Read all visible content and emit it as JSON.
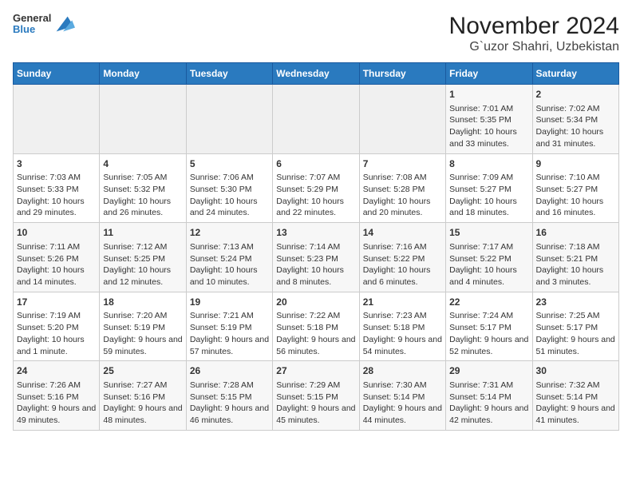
{
  "header": {
    "logo_line1": "General",
    "logo_line2": "Blue",
    "title": "November 2024",
    "subtitle": "G`uzor Shahri, Uzbekistan"
  },
  "weekdays": [
    "Sunday",
    "Monday",
    "Tuesday",
    "Wednesday",
    "Thursday",
    "Friday",
    "Saturday"
  ],
  "weeks": [
    [
      {
        "day": "",
        "info": ""
      },
      {
        "day": "",
        "info": ""
      },
      {
        "day": "",
        "info": ""
      },
      {
        "day": "",
        "info": ""
      },
      {
        "day": "",
        "info": ""
      },
      {
        "day": "1",
        "info": "Sunrise: 7:01 AM\nSunset: 5:35 PM\nDaylight: 10 hours and 33 minutes."
      },
      {
        "day": "2",
        "info": "Sunrise: 7:02 AM\nSunset: 5:34 PM\nDaylight: 10 hours and 31 minutes."
      }
    ],
    [
      {
        "day": "3",
        "info": "Sunrise: 7:03 AM\nSunset: 5:33 PM\nDaylight: 10 hours and 29 minutes."
      },
      {
        "day": "4",
        "info": "Sunrise: 7:05 AM\nSunset: 5:32 PM\nDaylight: 10 hours and 26 minutes."
      },
      {
        "day": "5",
        "info": "Sunrise: 7:06 AM\nSunset: 5:30 PM\nDaylight: 10 hours and 24 minutes."
      },
      {
        "day": "6",
        "info": "Sunrise: 7:07 AM\nSunset: 5:29 PM\nDaylight: 10 hours and 22 minutes."
      },
      {
        "day": "7",
        "info": "Sunrise: 7:08 AM\nSunset: 5:28 PM\nDaylight: 10 hours and 20 minutes."
      },
      {
        "day": "8",
        "info": "Sunrise: 7:09 AM\nSunset: 5:27 PM\nDaylight: 10 hours and 18 minutes."
      },
      {
        "day": "9",
        "info": "Sunrise: 7:10 AM\nSunset: 5:27 PM\nDaylight: 10 hours and 16 minutes."
      }
    ],
    [
      {
        "day": "10",
        "info": "Sunrise: 7:11 AM\nSunset: 5:26 PM\nDaylight: 10 hours and 14 minutes."
      },
      {
        "day": "11",
        "info": "Sunrise: 7:12 AM\nSunset: 5:25 PM\nDaylight: 10 hours and 12 minutes."
      },
      {
        "day": "12",
        "info": "Sunrise: 7:13 AM\nSunset: 5:24 PM\nDaylight: 10 hours and 10 minutes."
      },
      {
        "day": "13",
        "info": "Sunrise: 7:14 AM\nSunset: 5:23 PM\nDaylight: 10 hours and 8 minutes."
      },
      {
        "day": "14",
        "info": "Sunrise: 7:16 AM\nSunset: 5:22 PM\nDaylight: 10 hours and 6 minutes."
      },
      {
        "day": "15",
        "info": "Sunrise: 7:17 AM\nSunset: 5:22 PM\nDaylight: 10 hours and 4 minutes."
      },
      {
        "day": "16",
        "info": "Sunrise: 7:18 AM\nSunset: 5:21 PM\nDaylight: 10 hours and 3 minutes."
      }
    ],
    [
      {
        "day": "17",
        "info": "Sunrise: 7:19 AM\nSunset: 5:20 PM\nDaylight: 10 hours and 1 minute."
      },
      {
        "day": "18",
        "info": "Sunrise: 7:20 AM\nSunset: 5:19 PM\nDaylight: 9 hours and 59 minutes."
      },
      {
        "day": "19",
        "info": "Sunrise: 7:21 AM\nSunset: 5:19 PM\nDaylight: 9 hours and 57 minutes."
      },
      {
        "day": "20",
        "info": "Sunrise: 7:22 AM\nSunset: 5:18 PM\nDaylight: 9 hours and 56 minutes."
      },
      {
        "day": "21",
        "info": "Sunrise: 7:23 AM\nSunset: 5:18 PM\nDaylight: 9 hours and 54 minutes."
      },
      {
        "day": "22",
        "info": "Sunrise: 7:24 AM\nSunset: 5:17 PM\nDaylight: 9 hours and 52 minutes."
      },
      {
        "day": "23",
        "info": "Sunrise: 7:25 AM\nSunset: 5:17 PM\nDaylight: 9 hours and 51 minutes."
      }
    ],
    [
      {
        "day": "24",
        "info": "Sunrise: 7:26 AM\nSunset: 5:16 PM\nDaylight: 9 hours and 49 minutes."
      },
      {
        "day": "25",
        "info": "Sunrise: 7:27 AM\nSunset: 5:16 PM\nDaylight: 9 hours and 48 minutes."
      },
      {
        "day": "26",
        "info": "Sunrise: 7:28 AM\nSunset: 5:15 PM\nDaylight: 9 hours and 46 minutes."
      },
      {
        "day": "27",
        "info": "Sunrise: 7:29 AM\nSunset: 5:15 PM\nDaylight: 9 hours and 45 minutes."
      },
      {
        "day": "28",
        "info": "Sunrise: 7:30 AM\nSunset: 5:14 PM\nDaylight: 9 hours and 44 minutes."
      },
      {
        "day": "29",
        "info": "Sunrise: 7:31 AM\nSunset: 5:14 PM\nDaylight: 9 hours and 42 minutes."
      },
      {
        "day": "30",
        "info": "Sunrise: 7:32 AM\nSunset: 5:14 PM\nDaylight: 9 hours and 41 minutes."
      }
    ]
  ]
}
